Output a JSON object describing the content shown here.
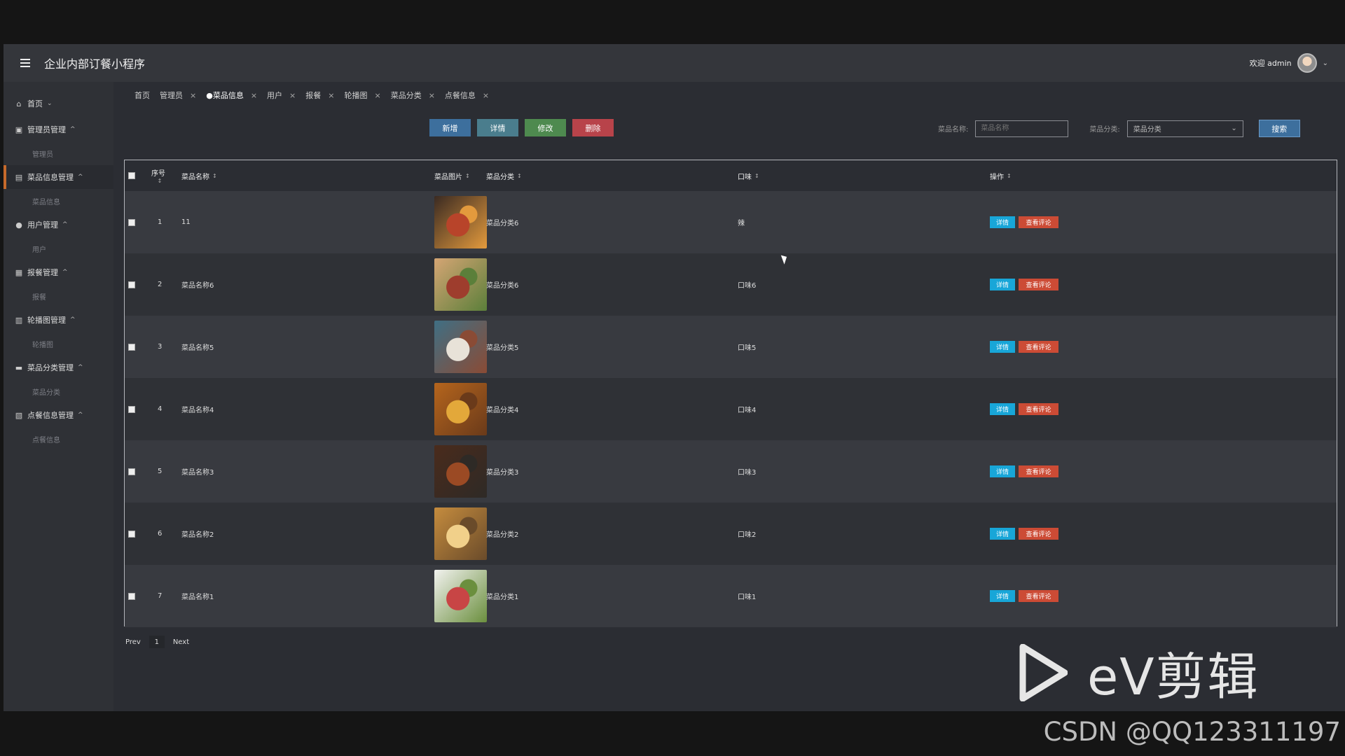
{
  "app": {
    "title": "企业内部订餐小程序",
    "welcome": "欢迎 admin"
  },
  "sidebar": {
    "groups": [
      {
        "label": "首页",
        "icon": "home-icon",
        "sub": ""
      },
      {
        "label": "管理员管理",
        "icon": "admin-icon",
        "sub": "管理员"
      },
      {
        "label": "菜品信息管理",
        "icon": "dish-icon",
        "sub": "菜品信息",
        "active": true
      },
      {
        "label": "用户管理",
        "icon": "user-icon",
        "sub": "用户"
      },
      {
        "label": "报餐管理",
        "icon": "meal-icon",
        "sub": "报餐"
      },
      {
        "label": "轮播图管理",
        "icon": "carousel-icon",
        "sub": "轮播图"
      },
      {
        "label": "菜品分类管理",
        "icon": "category-icon",
        "sub": "菜品分类"
      },
      {
        "label": "点餐信息管理",
        "icon": "order-icon",
        "sub": "点餐信息"
      }
    ]
  },
  "tabs": [
    "首页",
    "管理员",
    "●菜品信息",
    "用户",
    "报餐",
    "轮播图",
    "菜品分类",
    "点餐信息"
  ],
  "toolbar": {
    "add": "新增",
    "detail": "详情",
    "edit": "修改",
    "delete": "删除"
  },
  "search": {
    "name_label": "菜品名称:",
    "name_placeholder": "菜品名称",
    "category_label": "菜品分类:",
    "category_placeholder": "菜品分类",
    "button": "搜索"
  },
  "table": {
    "headers": {
      "index": "序号",
      "name": "菜品名称",
      "image": "菜品图片",
      "category": "菜品分类",
      "taste": "口味",
      "ops": "操作"
    },
    "rows": [
      {
        "index": "1",
        "name": "11",
        "category": "菜品分类6",
        "taste": "辣",
        "image_colors": [
          "#3a2a22",
          "#b8442a",
          "#e39a3d"
        ]
      },
      {
        "index": "2",
        "name": "菜品名称6",
        "category": "菜品分类6",
        "taste": "口味6",
        "image_colors": [
          "#d5a574",
          "#9e3d2d",
          "#5b7f3a"
        ]
      },
      {
        "index": "3",
        "name": "菜品名称5",
        "category": "菜品分类5",
        "taste": "口味5",
        "image_colors": [
          "#3f6f84",
          "#e8e2d8",
          "#8a4b35"
        ]
      },
      {
        "index": "4",
        "name": "菜品名称4",
        "category": "菜品分类4",
        "taste": "口味4",
        "image_colors": [
          "#b5651d",
          "#e3a83a",
          "#6a3a1a"
        ]
      },
      {
        "index": "5",
        "name": "菜品名称3",
        "category": "菜品分类3",
        "taste": "口味3",
        "image_colors": [
          "#4a2b1c",
          "#9b4a24",
          "#2e2a26"
        ]
      },
      {
        "index": "6",
        "name": "菜品名称2",
        "category": "菜品分类2",
        "taste": "口味2",
        "image_colors": [
          "#c58c3e",
          "#f1d08a",
          "#6a4b2a"
        ]
      },
      {
        "index": "7",
        "name": "菜品名称1",
        "category": "菜品分类1",
        "taste": "口味1",
        "image_colors": [
          "#f2f2ef",
          "#c84545",
          "#6b8f3e"
        ]
      }
    ],
    "detail_btn": "详情",
    "review_btn": "查看评论"
  },
  "pager": {
    "prev": "Prev",
    "page": "1",
    "next": "Next"
  },
  "watermark": {
    "text": "eV剪辑",
    "credit": "CSDN @QQ123311197"
  }
}
